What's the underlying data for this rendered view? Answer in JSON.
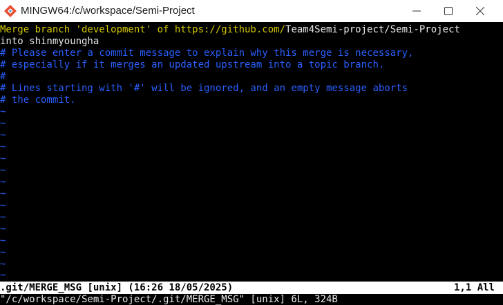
{
  "window": {
    "title": "MINGW64:/c/workspace/Semi-Project",
    "app_icon": "git-bash-icon"
  },
  "editor": {
    "line1": {
      "part1": "Merge branch 'development' of https://github.com/",
      "part2": "Team4Semi-project/Semi-Project"
    },
    "line2": "into shinmyoungha",
    "line3": "# Please enter a commit message to explain why this merge is necessary,",
    "line4": "# especially if it merges an updated upstream into a topic branch.",
    "line5": "#",
    "line6": "# Lines starting with '#' will be ignored, and an empty message aborts",
    "line7": "# the commit.",
    "tilde": "~"
  },
  "status_bar": {
    "left": ".git/MERGE_MSG [unix] (16:26 18/05/2025)",
    "right": "1,1 All"
  },
  "command_line": "\"/c/workspace/Semi-Project/.git/MERGE_MSG\" [unix] 6L, 324B",
  "colors": {
    "yellow_text": "#d4c700",
    "comment_blue": "#2a5fff",
    "background": "#000000"
  }
}
